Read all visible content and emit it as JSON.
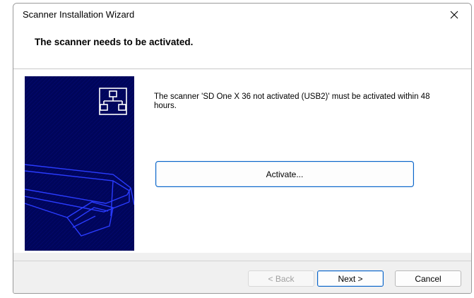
{
  "window": {
    "title": "Scanner Installation Wizard",
    "close_glyph": "✕"
  },
  "header": {
    "title": "The scanner needs to be activated."
  },
  "content": {
    "message": "The scanner 'SD One X 36 not activated (USB2)' must be activated within 48 hours.",
    "activate_label": "Activate...",
    "side_image_icon": "network-topology-icon",
    "side_image_background": "#00055a"
  },
  "footer": {
    "back_label": "< Back",
    "next_label": "Next >",
    "cancel_label": "Cancel"
  },
  "colors": {
    "accent_border": "#0a64c8",
    "side_panel": "#00055a",
    "side_line": "#2a3cff"
  }
}
